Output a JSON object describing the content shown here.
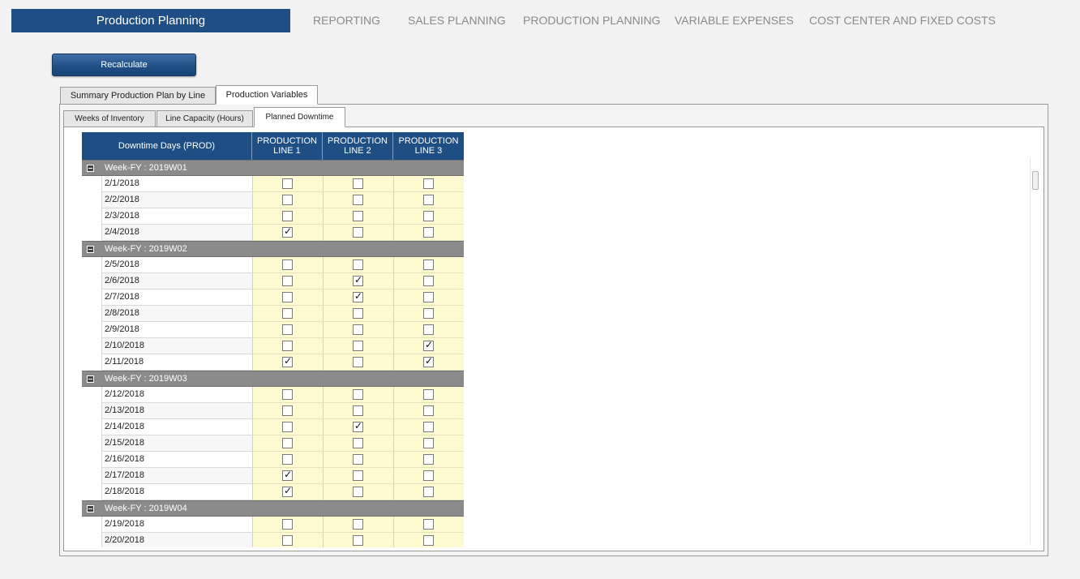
{
  "header": {
    "app_title": "Production Planning",
    "nav": [
      "REPORTING",
      "SALES PLANNING",
      "PRODUCTION PLANNING",
      "VARIABLE EXPENSES",
      "COST CENTER AND FIXED COSTS"
    ]
  },
  "toolbar": {
    "recalculate_label": "Recalculate"
  },
  "outer_tabs": [
    "Summary Production Plan by Line",
    "Production Variables"
  ],
  "inner_tabs": [
    "Weeks of Inventory",
    "Line Capacity (Hours)",
    "Planned Downtime"
  ],
  "grid": {
    "columns": [
      "Downtime Days (PROD)",
      "PRODUCTION LINE 1",
      "PRODUCTION LINE 2",
      "PRODUCTION LINE 3"
    ],
    "column_header_lines": [
      [
        "Downtime Days (PROD)"
      ],
      [
        "PRODUCTION",
        "LINE 1"
      ],
      [
        "PRODUCTION",
        "LINE 2"
      ],
      [
        "PRODUCTION",
        "LINE 3"
      ]
    ],
    "groups": [
      {
        "label": "Week-FY : 2019W01",
        "rows": [
          {
            "date": "2/1/2018",
            "line1": false,
            "line2": false,
            "line3": false
          },
          {
            "date": "2/2/2018",
            "line1": false,
            "line2": false,
            "line3": false
          },
          {
            "date": "2/3/2018",
            "line1": false,
            "line2": false,
            "line3": false
          },
          {
            "date": "2/4/2018",
            "line1": true,
            "line2": false,
            "line3": false
          }
        ]
      },
      {
        "label": "Week-FY : 2019W02",
        "rows": [
          {
            "date": "2/5/2018",
            "line1": false,
            "line2": false,
            "line3": false
          },
          {
            "date": "2/6/2018",
            "line1": false,
            "line2": true,
            "line3": false
          },
          {
            "date": "2/7/2018",
            "line1": false,
            "line2": true,
            "line3": false
          },
          {
            "date": "2/8/2018",
            "line1": false,
            "line2": false,
            "line3": false
          },
          {
            "date": "2/9/2018",
            "line1": false,
            "line2": false,
            "line3": false
          },
          {
            "date": "2/10/2018",
            "line1": false,
            "line2": false,
            "line3": true
          },
          {
            "date": "2/11/2018",
            "line1": true,
            "line2": false,
            "line3": true
          }
        ]
      },
      {
        "label": "Week-FY : 2019W03",
        "rows": [
          {
            "date": "2/12/2018",
            "line1": false,
            "line2": false,
            "line3": false
          },
          {
            "date": "2/13/2018",
            "line1": false,
            "line2": false,
            "line3": false
          },
          {
            "date": "2/14/2018",
            "line1": false,
            "line2": true,
            "line3": false
          },
          {
            "date": "2/15/2018",
            "line1": false,
            "line2": false,
            "line3": false
          },
          {
            "date": "2/16/2018",
            "line1": false,
            "line2": false,
            "line3": false
          },
          {
            "date": "2/17/2018",
            "line1": true,
            "line2": false,
            "line3": false
          },
          {
            "date": "2/18/2018",
            "line1": true,
            "line2": false,
            "line3": false
          }
        ]
      },
      {
        "label": "Week-FY : 2019W04",
        "rows": [
          {
            "date": "2/19/2018",
            "line1": false,
            "line2": false,
            "line3": false
          },
          {
            "date": "2/20/2018",
            "line1": false,
            "line2": false,
            "line3": false
          }
        ]
      }
    ]
  },
  "colors": {
    "header_blue": "#1f4e85",
    "group_gray": "#8b8b8b",
    "checkbox_cell_yellow": "#fdf9d0",
    "nav_text": "#8a8a8a"
  }
}
